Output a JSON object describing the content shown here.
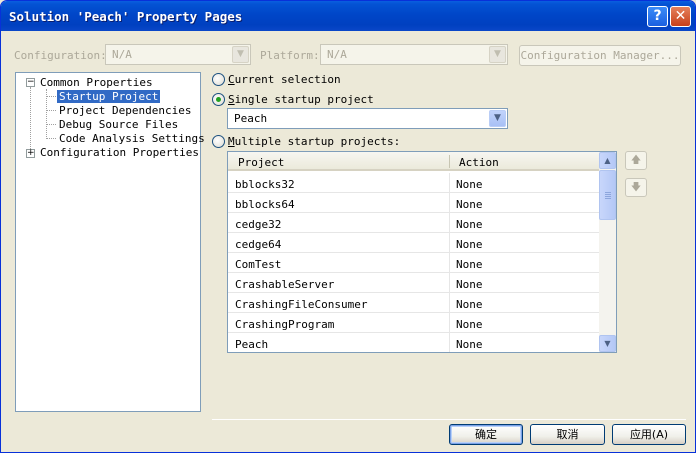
{
  "window": {
    "title": "Solution 'Peach' Property Pages",
    "help_glyph": "?",
    "close_glyph": "✕"
  },
  "top": {
    "configuration_label": "Configuration:",
    "configuration_value": "N/A",
    "platform_label": "Platform:",
    "platform_value": "N/A",
    "config_manager_label": "Configuration Manager..."
  },
  "tree": {
    "common_properties": "Common Properties",
    "startup_project": "Startup Project",
    "project_dependencies": "Project Dependencies",
    "debug_source_files": "Debug Source Files",
    "code_analysis_settings": "Code Analysis Settings",
    "configuration_properties": "Configuration Properties",
    "expanded_glyph": "−",
    "collapsed_glyph": "+"
  },
  "options": {
    "current_selection": "urrent selection",
    "current_selection_key": "C",
    "single_startup_key": "S",
    "single_startup": "ingle startup project",
    "single_startup_value": "Peach",
    "multiple_startup_key": "M",
    "multiple_startup": "ultiple startup projects:",
    "selected_option": "single"
  },
  "grid": {
    "columns": [
      "Project",
      "Action"
    ],
    "rows": [
      {
        "project": "bblocks32",
        "action": "None"
      },
      {
        "project": "bblocks64",
        "action": "None"
      },
      {
        "project": "cedge32",
        "action": "None"
      },
      {
        "project": "cedge64",
        "action": "None"
      },
      {
        "project": "ComTest",
        "action": "None"
      },
      {
        "project": "CrashableServer",
        "action": "None"
      },
      {
        "project": "CrashingFileConsumer",
        "action": "None"
      },
      {
        "project": "CrashingProgram",
        "action": "None"
      },
      {
        "project": "Peach",
        "action": "None"
      }
    ]
  },
  "move_buttons": {
    "up_icon": "up-arrow-icon",
    "down_icon": "down-arrow-icon",
    "up_glyph": "🡅",
    "down_glyph": "🡇"
  },
  "buttons": {
    "ok": "确定",
    "cancel": "取消",
    "apply": "应用(A)"
  },
  "colors": {
    "titlebar": "#0046c8",
    "selection": "#316ac5",
    "dialog_bg": "#ece9d8"
  }
}
